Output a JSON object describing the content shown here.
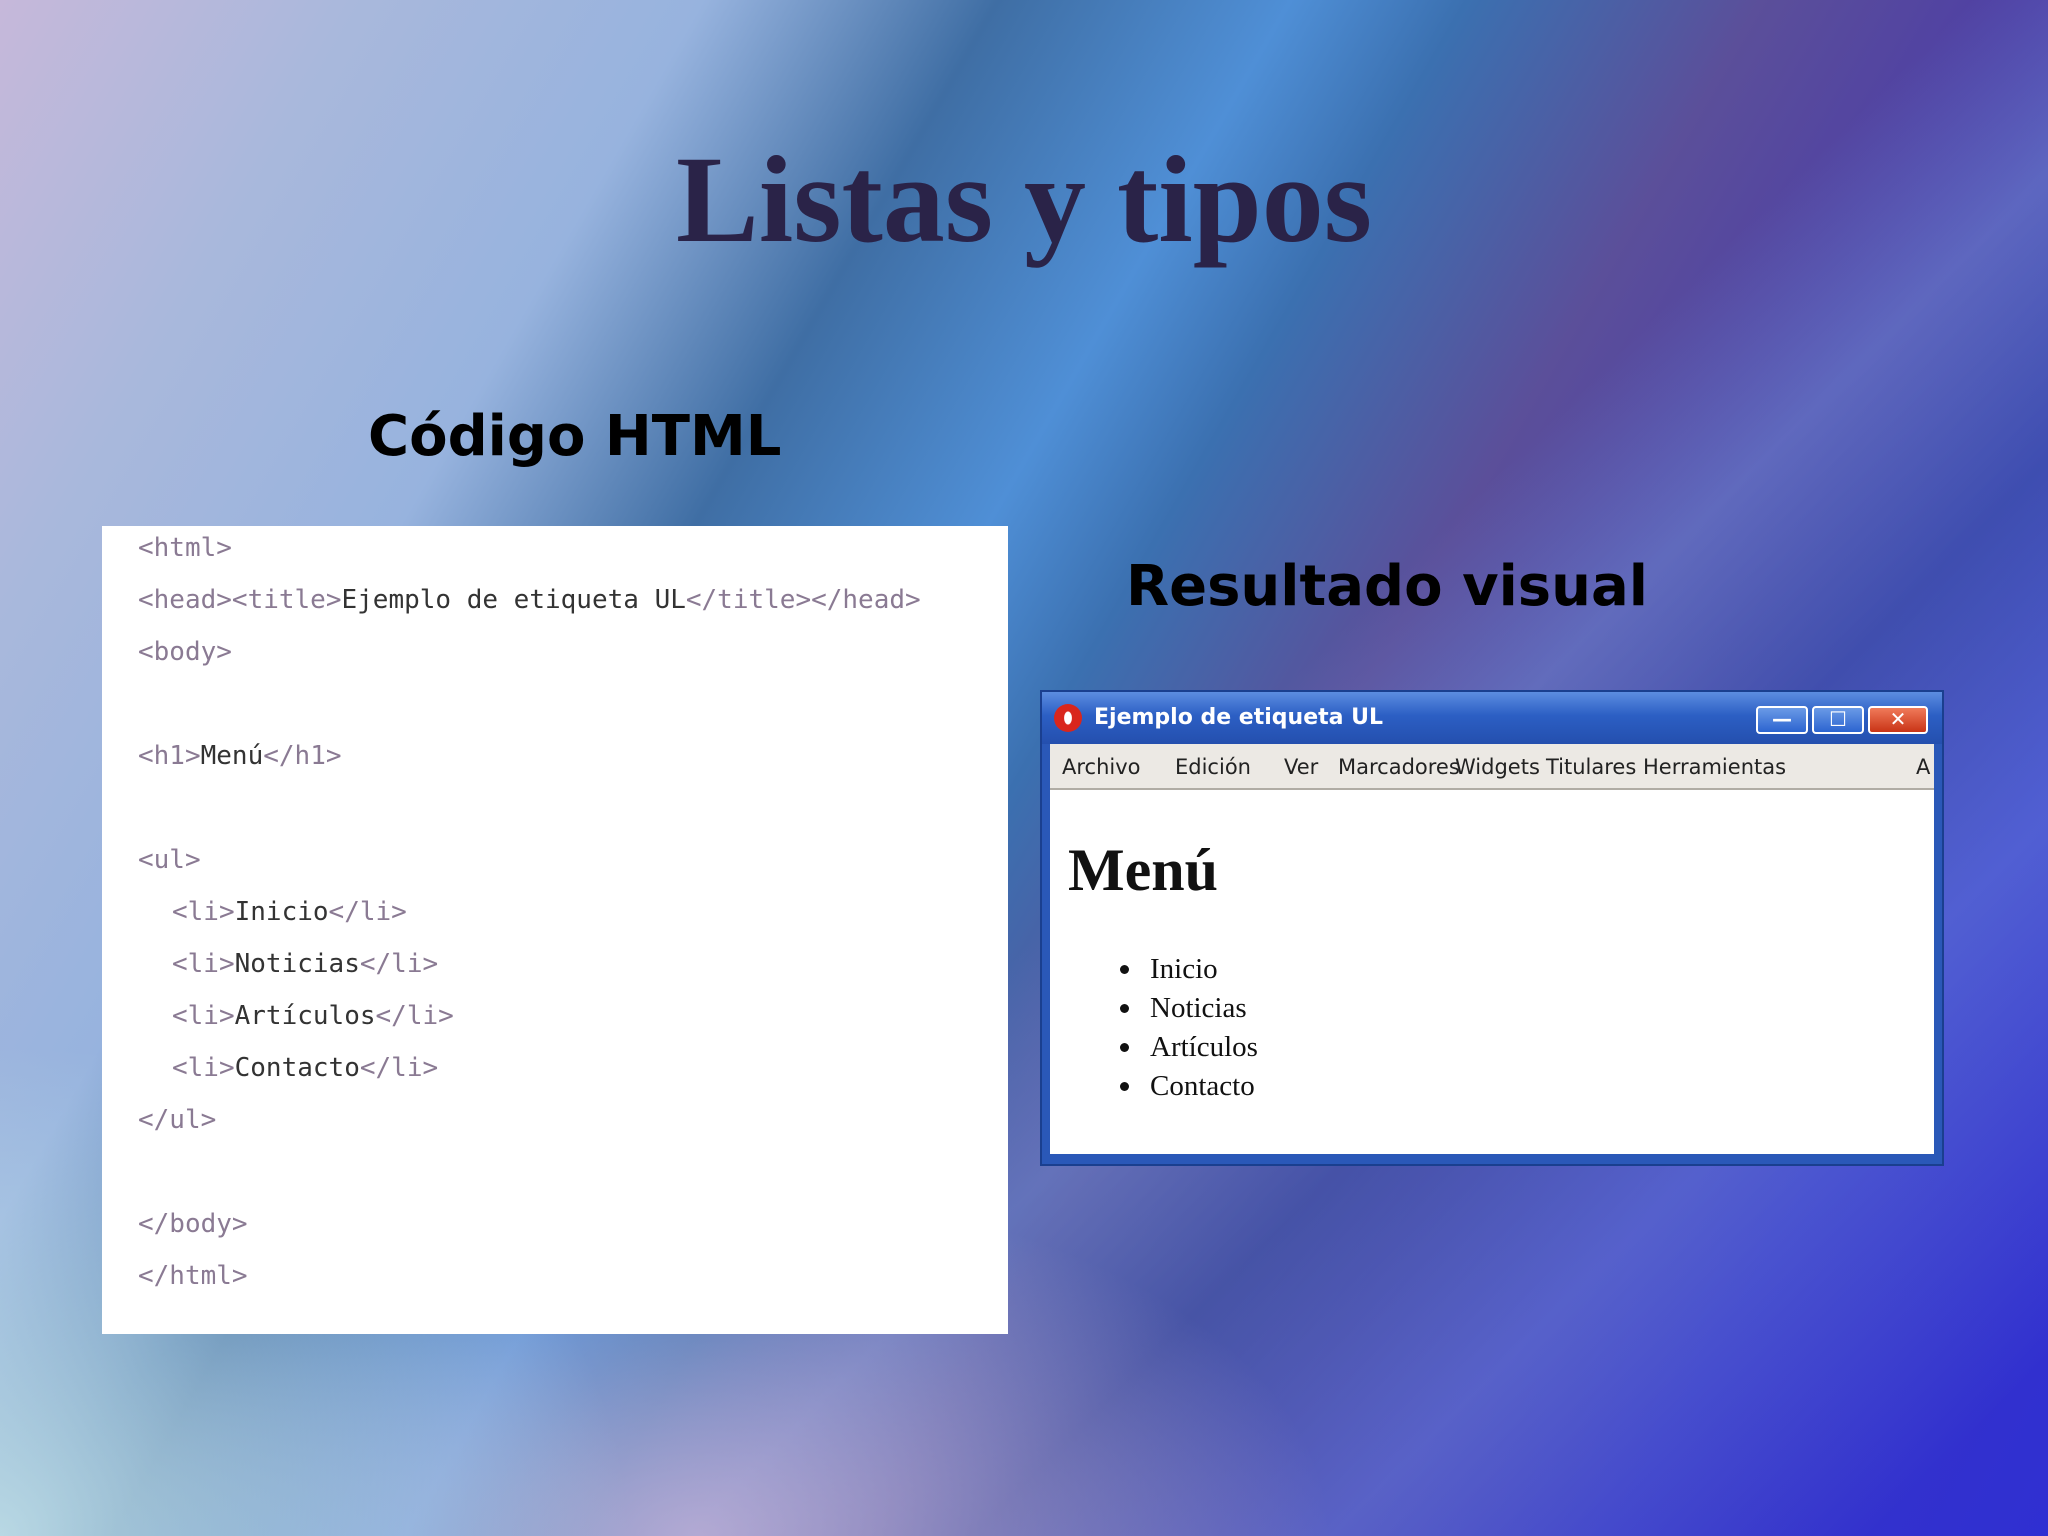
{
  "slide": {
    "title": "Listas y tipos",
    "code_label": "Código HTML",
    "visual_label": "Resultado visual"
  },
  "code": {
    "lines": [
      {
        "tag": "<html>",
        "text": "",
        "indent": 0
      },
      {
        "tag": "<head><title>",
        "text": "Ejemplo de etiqueta UL",
        "tag2": "</title></head>",
        "indent": 0
      },
      {
        "tag": "<body>",
        "text": "",
        "indent": 0
      },
      {
        "tag": "",
        "text": "",
        "indent": 0
      },
      {
        "tag": "<h1>",
        "text": "Menú",
        "tag2": "</h1>",
        "indent": 0
      },
      {
        "tag": "",
        "text": "",
        "indent": 0
      },
      {
        "tag": "<ul>",
        "text": "",
        "indent": 0
      },
      {
        "tag": "<li>",
        "text": "Inicio",
        "tag2": "</li>",
        "indent": 1
      },
      {
        "tag": "<li>",
        "text": "Noticias",
        "tag2": "</li>",
        "indent": 1
      },
      {
        "tag": "<li>",
        "text": "Artículos",
        "tag2": "</li>",
        "indent": 1
      },
      {
        "tag": "<li>",
        "text": "Contacto",
        "tag2": "</li>",
        "indent": 1
      },
      {
        "tag": "</ul>",
        "text": "",
        "indent": 0
      },
      {
        "tag": "",
        "text": "",
        "indent": 0
      },
      {
        "tag": "</body>",
        "text": "",
        "indent": 0
      },
      {
        "tag": "</html>",
        "text": "",
        "indent": 0
      }
    ]
  },
  "browser": {
    "window_title": "Ejemplo de etiqueta UL",
    "minimize_glyph": "—",
    "maximize_glyph": "☐",
    "close_glyph": "✕",
    "menu": [
      "Archivo",
      "Edición",
      "Ver",
      "Marcadores",
      "Widgets",
      "Titulares",
      "Herramientas",
      "A"
    ],
    "page_heading": "Menú",
    "page_list": [
      "Inicio",
      "Noticias",
      "Artículos",
      "Contacto"
    ],
    "icon": "opera-logo-icon"
  },
  "colors": {
    "title": "#2a2348",
    "titlebar": "#2c5fc4",
    "close_button": "#c93416"
  }
}
